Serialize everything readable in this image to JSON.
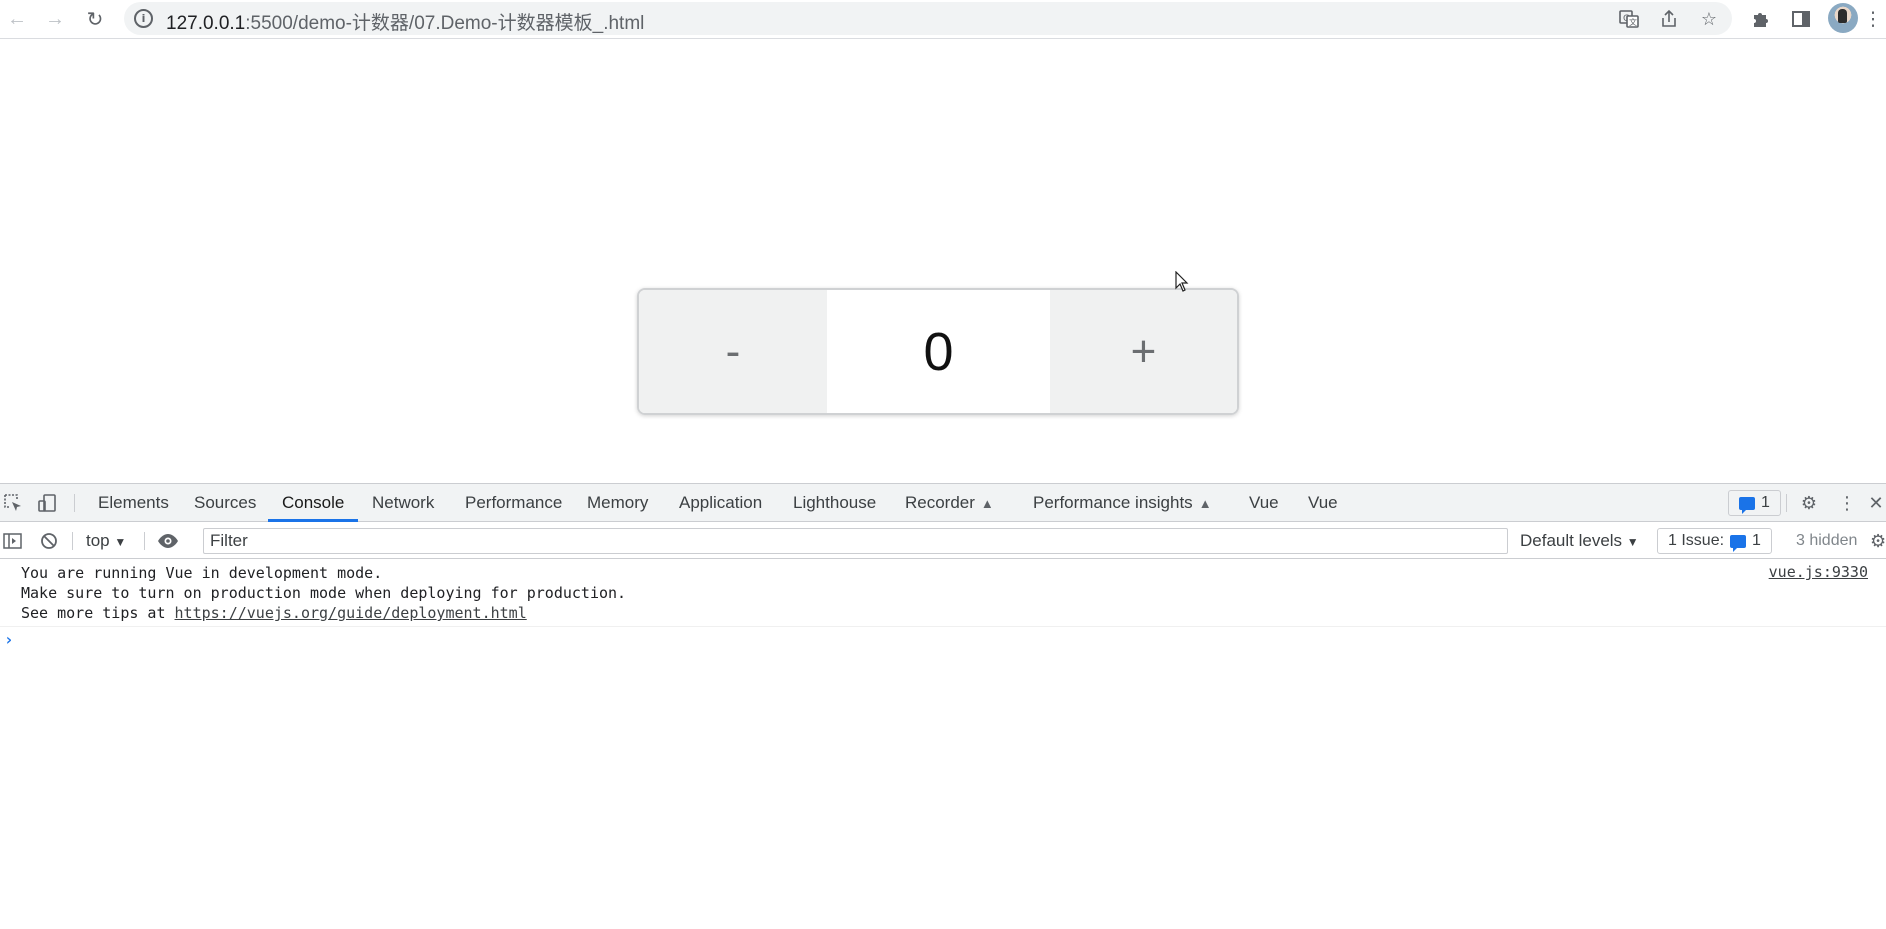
{
  "browser": {
    "url_host": "127.0.0.1",
    "url_rest": ":5500/demo-计数器/07.Demo-计数器模板_.html"
  },
  "counter": {
    "minus_label": "-",
    "value": "0",
    "plus_label": "+"
  },
  "devtools": {
    "tabs": [
      "Elements",
      "Sources",
      "Console",
      "Network",
      "Performance",
      "Memory",
      "Application",
      "Lighthouse",
      "Recorder",
      "Performance insights",
      "Vue",
      "Vue"
    ],
    "active_tab": "Console",
    "issues_badge": "1",
    "context": "top",
    "filter_placeholder": "Filter",
    "levels": "Default levels",
    "issues_label": "1 Issue:",
    "issues_count": "1",
    "hidden": "3 hidden"
  },
  "console": {
    "line1": "You are running Vue in development mode.",
    "line2": "Make sure to turn on production mode when deploying for production.",
    "line3_prefix": "See more tips at ",
    "line3_link": "https://vuejs.org/guide/deployment.html",
    "source": "vue.js:9330"
  },
  "colors": {
    "accent": "#1a73e8",
    "button_bg": "#f0f1f1"
  }
}
